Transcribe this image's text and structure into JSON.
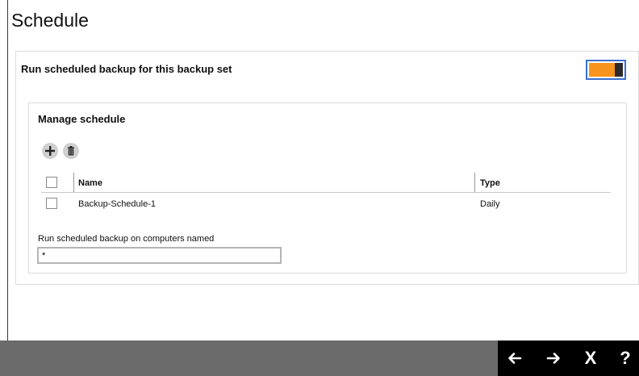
{
  "page": {
    "title": "Schedule"
  },
  "scheduled_backup": {
    "label": "Run scheduled backup for this backup set",
    "enabled": true,
    "toggle_color": "#f7941d"
  },
  "manage_schedule": {
    "title": "Manage schedule",
    "toolbar": {
      "add_icon": "plus-icon",
      "delete_icon": "trash-icon"
    },
    "table": {
      "columns": [
        "Name",
        "Type"
      ],
      "rows": [
        {
          "name": "Backup-Schedule-1",
          "type": "Daily",
          "checked": false
        }
      ]
    },
    "computers": {
      "label": "Run scheduled backup on computers named",
      "value": "*"
    }
  },
  "footer": {
    "help_label": "?",
    "close_label": "X",
    "back_icon": "arrow-left-icon",
    "next_icon": "arrow-right-icon"
  }
}
